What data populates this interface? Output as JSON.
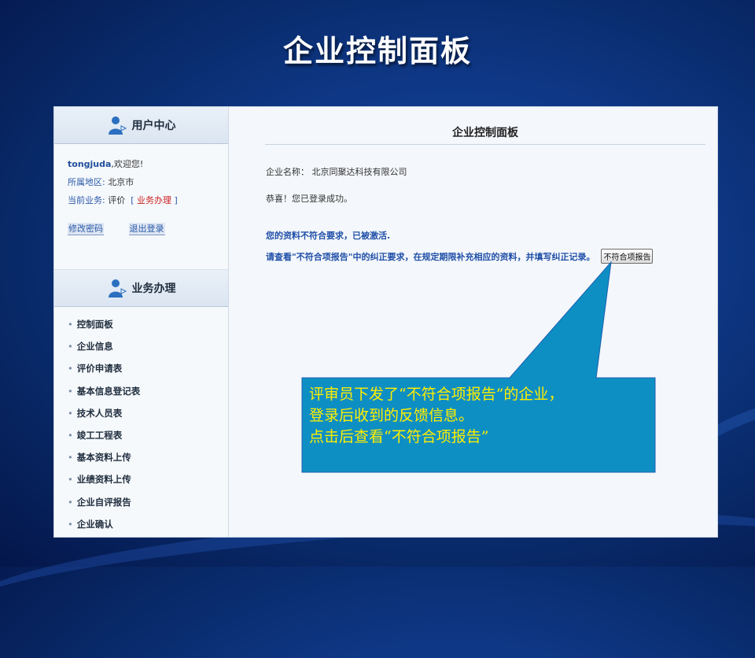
{
  "slide": {
    "title": "企业控制面板"
  },
  "sidebar": {
    "user_center_title": "用户中心",
    "username": "tongjuda",
    "welcome": ",欢迎您!",
    "region_label": "所属地区:",
    "region_value": "北京市",
    "business_label": "当前业务:",
    "business_value": "评价",
    "business_link": "业务办理",
    "bracket_open": "[",
    "bracket_close": "]",
    "change_password": "修改密码",
    "logout": "退出登录",
    "business_title": "业务办理",
    "menu_items": [
      "控制面板",
      "企业信息",
      "评价申请表",
      "基本信息登记表",
      "技术人员表",
      "竣工工程表",
      "基本资料上传",
      "业绩资料上传",
      "企业自评报告",
      "企业确认"
    ]
  },
  "main": {
    "title": "企业控制面板",
    "company_label": "企业名称：",
    "company_name": "北京同聚达科技有限公司",
    "congrats": "恭喜！您已登录成功。",
    "warning_line1": "您的资料不符合要求，已被激活.",
    "warning_line2": "请查看\"不符合项报告\"中的纠正要求，在规定期限补充相应的资料，并填写纠正记录。",
    "report_button": "不符合项报告"
  },
  "callout": {
    "line1": "评审员下发了“不符合项报告”的企业，",
    "line2": "登录后收到的反馈信息。",
    "line3": "点击后查看“不符合项报告”",
    "fill_color": "#0e8fc4",
    "text_color": "#ffee00"
  }
}
